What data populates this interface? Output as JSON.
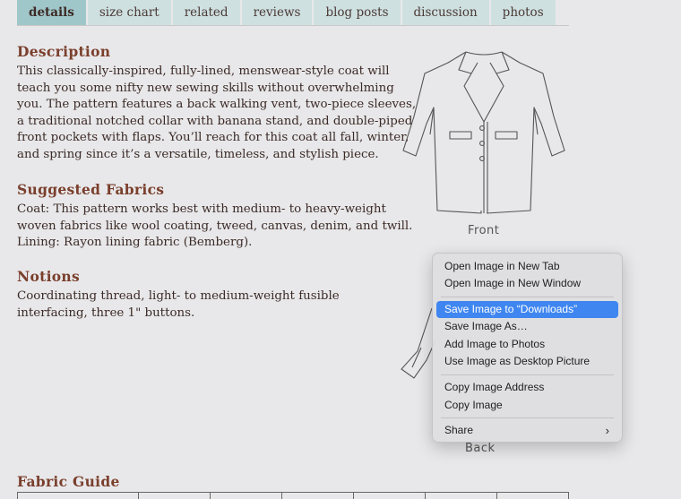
{
  "tabs": [
    {
      "label": "details",
      "active": true
    },
    {
      "label": "size chart"
    },
    {
      "label": "related"
    },
    {
      "label": "reviews"
    },
    {
      "label": "blog posts"
    },
    {
      "label": "discussion"
    },
    {
      "label": "photos"
    }
  ],
  "description": {
    "heading": "Description",
    "lines": [
      "This classically-inspired, fully-lined, menswear-style coat will",
      "teach you some nifty new sewing skills without overwhelming",
      "you. The pattern features a back walking vent, two-piece sleeves,",
      "a traditional notched collar with banana stand, and double-piped",
      "front pockets with flaps. You’ll reach for this coat all fall, winter,",
      "and spring since it’s a versatile, timeless, and stylish piece."
    ]
  },
  "fabrics": {
    "heading": "Suggested Fabrics",
    "lines": [
      "Coat: This pattern works best with medium- to heavy-weight",
      "woven fabrics like wool coating, tweed, canvas, denim, and twill.",
      "Lining: Rayon lining fabric (Bemberg)."
    ]
  },
  "notions": {
    "heading": "Notions",
    "lines": [
      "Coordinating thread, light- to medium-weight fusible",
      "interfacing, three 1\" buttons."
    ]
  },
  "images": {
    "front_caption": "Front",
    "back_caption": "Back"
  },
  "fabric_guide": {
    "heading": "Fabric Guide"
  },
  "context_menu": {
    "items": [
      "Open Image in New Tab",
      "Open Image in New Window",
      "Save Image to “Downloads”",
      "Save Image As…",
      "Add Image to Photos",
      "Use Image as Desktop Picture",
      "Copy Image Address",
      "Copy Image",
      "Share"
    ],
    "highlighted_index": 2,
    "highlight_color": "#3f86f0"
  }
}
